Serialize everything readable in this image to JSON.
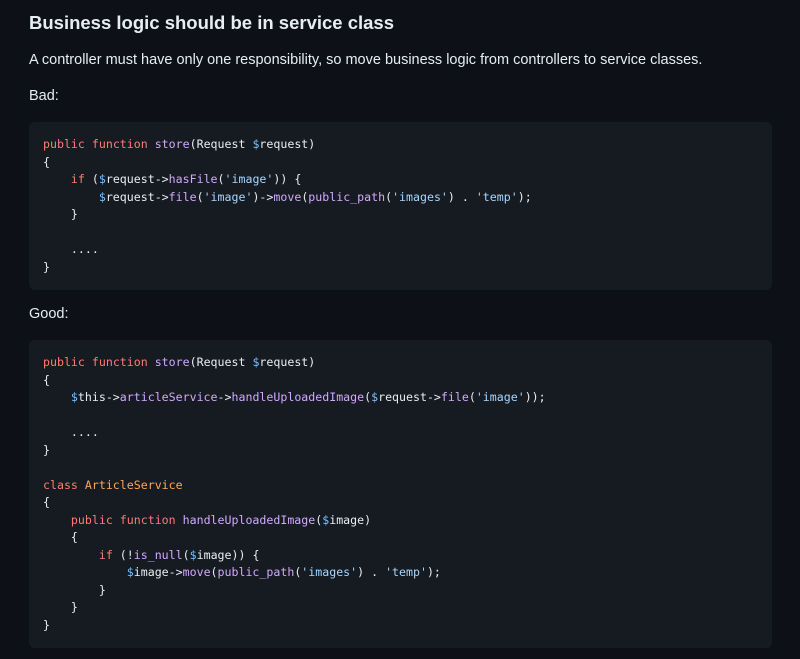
{
  "heading": "Business logic should be in service class",
  "description": "A controller must have only one responsibility, so move business logic from controllers to service classes.",
  "bad_label": "Bad:",
  "good_label": "Good:",
  "theme": {
    "background": "#0d1117",
    "code_background": "#161b22",
    "keyword": "#ff7b72",
    "function": "#d2a8ff",
    "variable": "#79c0ff",
    "string": "#a5d6ff",
    "class_name": "#ffa657",
    "text": "#e6edf3"
  },
  "bad_code": [
    [
      [
        "kw",
        "public"
      ],
      [
        "pl",
        " "
      ],
      [
        "kw",
        "function"
      ],
      [
        "pl",
        " "
      ],
      [
        "fn",
        "store"
      ],
      [
        "pl",
        "(Request "
      ],
      [
        "var",
        "$"
      ],
      [
        "pl",
        "request)"
      ]
    ],
    [
      [
        "pl",
        "{"
      ]
    ],
    [
      [
        "pl",
        "    "
      ],
      [
        "kw",
        "if"
      ],
      [
        "pl",
        " ("
      ],
      [
        "var",
        "$"
      ],
      [
        "pl",
        "request->"
      ],
      [
        "fn",
        "hasFile"
      ],
      [
        "pl",
        "("
      ],
      [
        "str",
        "'image'"
      ],
      [
        "pl",
        ")) {"
      ]
    ],
    [
      [
        "pl",
        "        "
      ],
      [
        "var",
        "$"
      ],
      [
        "pl",
        "request->"
      ],
      [
        "fn",
        "file"
      ],
      [
        "pl",
        "("
      ],
      [
        "str",
        "'image'"
      ],
      [
        "pl",
        ")->"
      ],
      [
        "fn",
        "move"
      ],
      [
        "pl",
        "("
      ],
      [
        "fn",
        "public_path"
      ],
      [
        "pl",
        "("
      ],
      [
        "str",
        "'images'"
      ],
      [
        "pl",
        ") . "
      ],
      [
        "str",
        "'temp'"
      ],
      [
        "pl",
        ");"
      ]
    ],
    [
      [
        "pl",
        "    }"
      ]
    ],
    [
      [
        "pl",
        ""
      ]
    ],
    [
      [
        "pl",
        "    ...."
      ]
    ],
    [
      [
        "pl",
        "}"
      ]
    ]
  ],
  "good_code": [
    [
      [
        "kw",
        "public"
      ],
      [
        "pl",
        " "
      ],
      [
        "kw",
        "function"
      ],
      [
        "pl",
        " "
      ],
      [
        "fn",
        "store"
      ],
      [
        "pl",
        "(Request "
      ],
      [
        "var",
        "$"
      ],
      [
        "pl",
        "request)"
      ]
    ],
    [
      [
        "pl",
        "{"
      ]
    ],
    [
      [
        "pl",
        "    "
      ],
      [
        "var",
        "$"
      ],
      [
        "pl",
        "this->"
      ],
      [
        "fn",
        "articleService"
      ],
      [
        "pl",
        "->"
      ],
      [
        "fn",
        "handleUploadedImage"
      ],
      [
        "pl",
        "("
      ],
      [
        "var",
        "$"
      ],
      [
        "pl",
        "request->"
      ],
      [
        "fn",
        "file"
      ],
      [
        "pl",
        "("
      ],
      [
        "str",
        "'image'"
      ],
      [
        "pl",
        "));"
      ]
    ],
    [
      [
        "pl",
        ""
      ]
    ],
    [
      [
        "pl",
        "    ...."
      ]
    ],
    [
      [
        "pl",
        "}"
      ]
    ],
    [
      [
        "pl",
        ""
      ]
    ],
    [
      [
        "kw",
        "class"
      ],
      [
        "pl",
        " "
      ],
      [
        "cls",
        "ArticleService"
      ]
    ],
    [
      [
        "pl",
        "{"
      ]
    ],
    [
      [
        "pl",
        "    "
      ],
      [
        "kw",
        "public"
      ],
      [
        "pl",
        " "
      ],
      [
        "kw",
        "function"
      ],
      [
        "pl",
        " "
      ],
      [
        "fn",
        "handleUploadedImage"
      ],
      [
        "pl",
        "("
      ],
      [
        "var",
        "$"
      ],
      [
        "pl",
        "image)"
      ]
    ],
    [
      [
        "pl",
        "    {"
      ]
    ],
    [
      [
        "pl",
        "        "
      ],
      [
        "kw",
        "if"
      ],
      [
        "pl",
        " (!"
      ],
      [
        "fn",
        "is_null"
      ],
      [
        "pl",
        "("
      ],
      [
        "var",
        "$"
      ],
      [
        "pl",
        "image)) {"
      ]
    ],
    [
      [
        "pl",
        "            "
      ],
      [
        "var",
        "$"
      ],
      [
        "pl",
        "image->"
      ],
      [
        "fn",
        "move"
      ],
      [
        "pl",
        "("
      ],
      [
        "fn",
        "public_path"
      ],
      [
        "pl",
        "("
      ],
      [
        "str",
        "'images'"
      ],
      [
        "pl",
        ") . "
      ],
      [
        "str",
        "'temp'"
      ],
      [
        "pl",
        ");"
      ]
    ],
    [
      [
        "pl",
        "        }"
      ]
    ],
    [
      [
        "pl",
        "    }"
      ]
    ],
    [
      [
        "pl",
        "}"
      ]
    ]
  ]
}
